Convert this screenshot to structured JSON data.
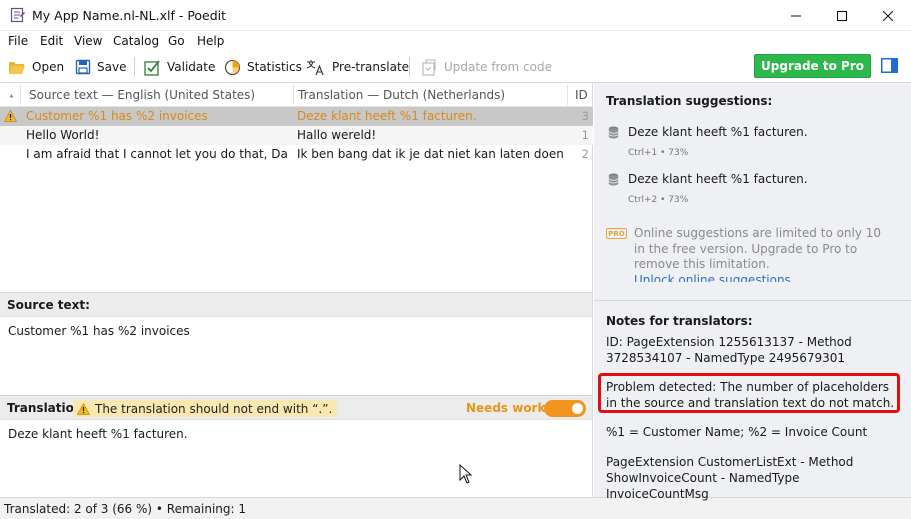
{
  "window": {
    "title": "My App Name.nl-NL.xlf - Poedit"
  },
  "menu": [
    "File",
    "Edit",
    "View",
    "Catalog",
    "Go",
    "Help"
  ],
  "toolbar": {
    "open": "Open",
    "save": "Save",
    "validate": "Validate",
    "statistics": "Statistics",
    "pretranslate": "Pre-translate",
    "update_from_code": "Update from code",
    "upgrade": "Upgrade to Pro"
  },
  "list": {
    "headers": {
      "source": "Source text — English (United States)",
      "translation": "Translation — Dutch (Netherlands)",
      "id": "ID"
    },
    "rows": [
      {
        "source": "Customer %1 has %2 invoices",
        "translation": "Deze klant heeft %1 facturen.",
        "id": "3"
      },
      {
        "source": "Hello World!",
        "translation": "Hallo wereld!",
        "id": "1"
      },
      {
        "source": "I am afraid that I cannot let you do that, Dave....",
        "translation": "Ik ben bang dat ik je dat niet kan laten doen, Dav...",
        "id": "2"
      }
    ]
  },
  "source_pane": {
    "label": "Source text:",
    "text": "Customer %1 has %2 invoices"
  },
  "translation_pane": {
    "label": "Translation:",
    "warning": "The translation should not end with “.”.",
    "needs_work": "Needs work",
    "text": "Deze klant heeft %1 facturen."
  },
  "status": {
    "text": "Translated: 2 of 3 (66 %)  •  Remaining: 1"
  },
  "sidebar": {
    "suggestions_title": "Translation suggestions:",
    "suggestions": [
      {
        "text": "Deze klant heeft %1 facturen.",
        "meta": "Ctrl+1 • 73%"
      },
      {
        "text": "Deze klant heeft %1 facturen.",
        "meta": "Ctrl+2 • 73%"
      }
    ],
    "pro_badge": "PRO",
    "pro_text": "Online suggestions are limited to only 10 in the free version. Upgrade to Pro to remove this limitation.",
    "pro_link": "Unlock online suggestions",
    "notes_title": "Notes for translators:",
    "note_id": "ID: PageExtension 1255613137 - Method 3728534107 - NamedType 2495679301",
    "note_problem": "Problem detected: The number of placeholders in the source and translation text do not match.",
    "note_placeholders": "%1 = Customer Name; %2 = Invoice Count",
    "note_context": "PageExtension CustomerListExt - Method ShowInvoiceCount - NamedType InvoiceCountMsg"
  },
  "colors": {
    "accent_green": "#2cb84b",
    "warning_orange": "#f0951e",
    "highlight_red": "#e01010"
  }
}
